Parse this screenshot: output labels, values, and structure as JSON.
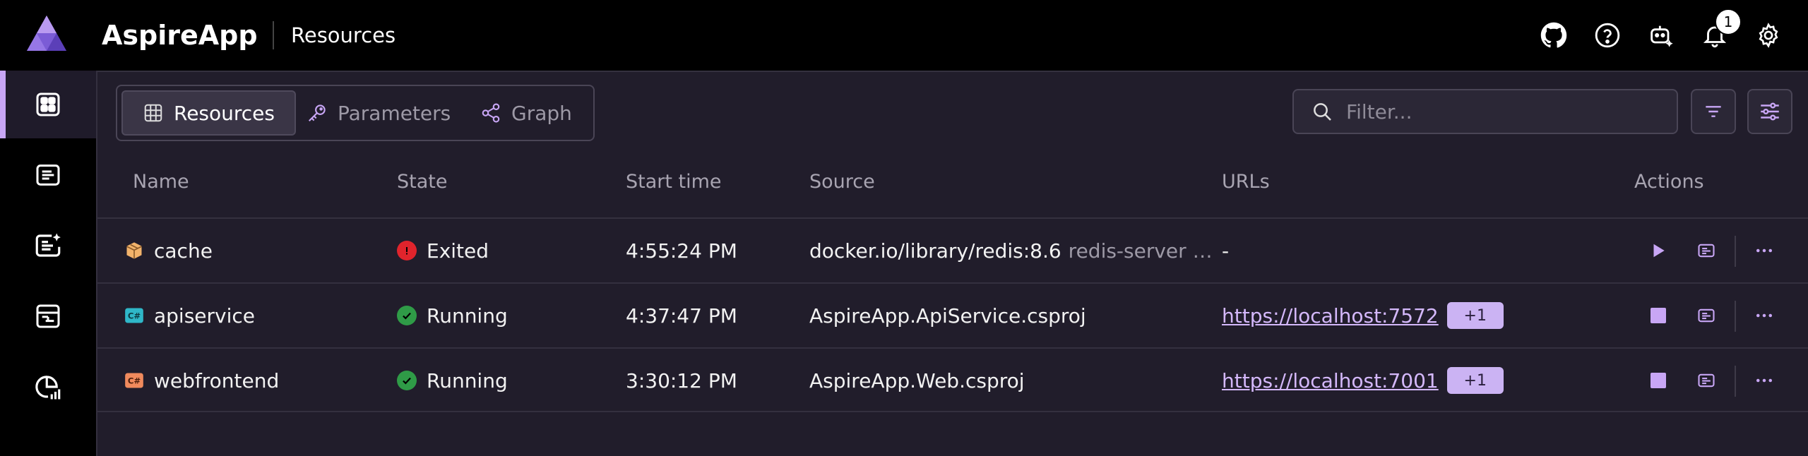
{
  "header": {
    "app_name": "AspireApp",
    "page_name": "Resources",
    "notification_count": "1",
    "icons": [
      "github-icon",
      "help-icon",
      "copilot-icon",
      "bell-icon",
      "gear-icon"
    ]
  },
  "sidebar": {
    "items": [
      {
        "icon": "resources-grid-icon",
        "active": true
      },
      {
        "icon": "console-logs-icon",
        "active": false
      },
      {
        "icon": "structured-logs-icon",
        "active": false
      },
      {
        "icon": "traces-icon",
        "active": false
      },
      {
        "icon": "metrics-icon",
        "active": false
      }
    ]
  },
  "tabs": [
    {
      "label": "Resources",
      "icon": "grid-icon",
      "active": true
    },
    {
      "label": "Parameters",
      "icon": "key-icon",
      "active": false
    },
    {
      "label": "Graph",
      "icon": "share-icon",
      "active": false
    }
  ],
  "filter": {
    "placeholder": "Filter..."
  },
  "table": {
    "headers": {
      "name": "Name",
      "state": "State",
      "start": "Start time",
      "source": "Source",
      "urls": "URLs",
      "actions": "Actions"
    },
    "rows": [
      {
        "name": "cache",
        "state": "Exited",
        "start": "4:55:24 PM",
        "source": "docker.io/library/redis:8.6",
        "source_extra": "redis-server …",
        "url": "-",
        "url_extra": ""
      },
      {
        "name": "apiservice",
        "state": "Running",
        "start": "4:37:47 PM",
        "source": "AspireApp.ApiService.csproj",
        "source_extra": "",
        "url": "https://localhost:7572",
        "url_extra": "+1"
      },
      {
        "name": "webfrontend",
        "state": "Running",
        "start": "3:30:12 PM",
        "source": "AspireApp.Web.csproj",
        "source_extra": "",
        "url": "https://localhost:7001",
        "url_extra": "+1"
      }
    ]
  },
  "colors": {
    "accent": "#c8a6f5",
    "exited": "#e0242c",
    "running": "#2f9b47",
    "panel": "#211d2b"
  }
}
